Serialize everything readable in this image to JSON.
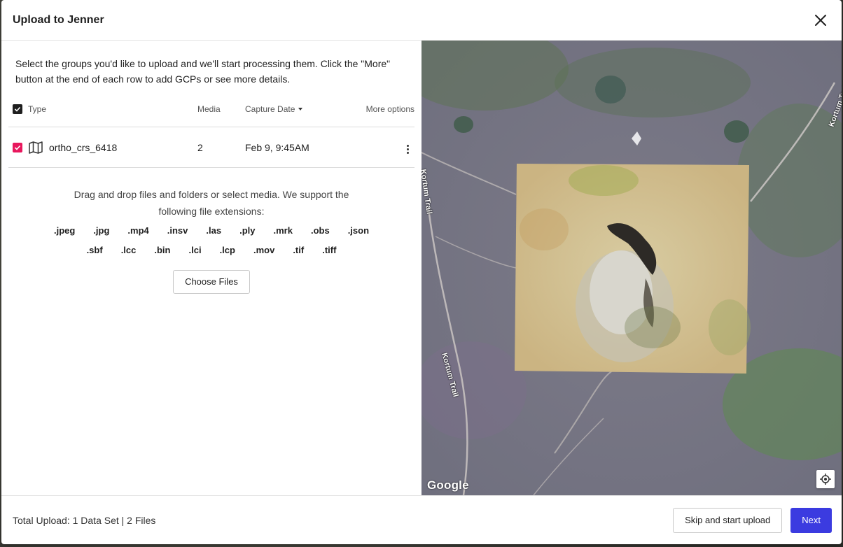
{
  "modal": {
    "title": "Upload to Jenner"
  },
  "intro_text": "Select the groups you'd like to upload and we'll start processing them. Click the \"More\" button at the end of each row to add GCPs or see more details.",
  "table": {
    "headers": {
      "type": "Type",
      "media": "Media",
      "capture_date": "Capture Date",
      "more_options": "More options"
    },
    "rows": [
      {
        "name": "ortho_crs_6418",
        "media": "2",
        "capture_date": "Feb 9, 9:45AM",
        "checked": true
      }
    ]
  },
  "dropzone": {
    "text_line1": "Drag and drop files and folders or select media. We support the",
    "text_line2": "following file extensions:",
    "extensions_row1": [
      ".jpeg",
      ".jpg",
      ".mp4",
      ".insv",
      ".las",
      ".ply",
      ".mrk",
      ".obs",
      ".json"
    ],
    "extensions_row2": [
      ".sbf",
      ".lcc",
      ".bin",
      ".lci",
      ".lcp",
      ".mov",
      ".tif",
      ".tiff"
    ],
    "choose_button": "Choose Files"
  },
  "map": {
    "trail_name": "Kortum Trail",
    "attribution": "Google"
  },
  "footer": {
    "summary": "Total Upload: 1 Data Set | 2 Files",
    "skip_button": "Skip and start upload",
    "next_button": "Next"
  },
  "colors": {
    "accent_primary": "#3b3be0",
    "row_checkbox": "#e8175d",
    "header_checkbox": "#1f1f1f"
  },
  "icons": {
    "close": "close-icon",
    "map": "map-icon",
    "kebab": "more-vertical-icon",
    "locate": "locate-icon",
    "sort": "caret-down-icon",
    "check": "check-icon"
  }
}
